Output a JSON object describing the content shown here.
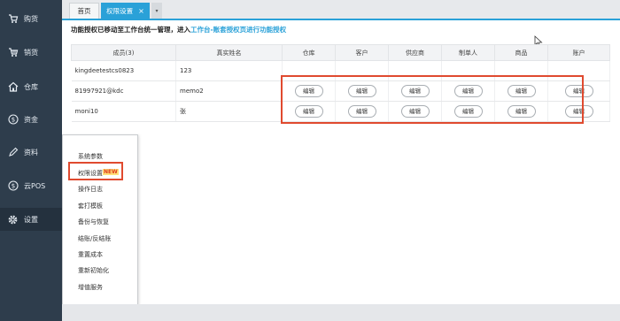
{
  "sidebar": {
    "items": [
      {
        "label": "购货",
        "icon": "cart-icon"
      },
      {
        "label": "销货",
        "icon": "sales-cart-icon"
      },
      {
        "label": "仓库",
        "icon": "warehouse-icon"
      },
      {
        "label": "资金",
        "icon": "money-icon"
      },
      {
        "label": "资料",
        "icon": "pencil-icon"
      },
      {
        "label": "云POS",
        "icon": "pos-icon"
      },
      {
        "label": "设置",
        "icon": "gear-icon"
      }
    ]
  },
  "tabs": {
    "home": "首页",
    "active": "权限设置",
    "close": "×",
    "dropdown": "▾"
  },
  "notice": {
    "text": "功能授权已移动至工作台统一管理，进入",
    "link": "工作台-账套授权页进行功能授权"
  },
  "table": {
    "headers": [
      "成员(3)",
      "真实姓名",
      "仓库",
      "客户",
      "供应商",
      "制单人",
      "商品",
      "账户"
    ],
    "rows": [
      {
        "member": "kingdeetestcs0823",
        "name": "123",
        "edit": [
          "",
          "",
          "",
          "",
          "",
          ""
        ]
      },
      {
        "member": "81997921@kdc",
        "name": "memo2",
        "edit": [
          "编辑",
          "编辑",
          "编辑",
          "编辑",
          "编辑",
          "编辑"
        ]
      },
      {
        "member": "moni10",
        "name": "张",
        "edit": [
          "编辑",
          "编辑",
          "编辑",
          "编辑",
          "编辑",
          "编辑"
        ]
      }
    ]
  },
  "menu": {
    "items": [
      "系统参数",
      "权限设置",
      "操作日志",
      "套打模板",
      "备份与恢复",
      "结账/反结账",
      "重置成本",
      "重新初始化",
      "增值服务"
    ],
    "new_badge": "NEW"
  },
  "colors": {
    "sidebar_bg": "#2e3d4c",
    "accent": "#2aa1d8",
    "highlight_red": "#e04a2f"
  }
}
